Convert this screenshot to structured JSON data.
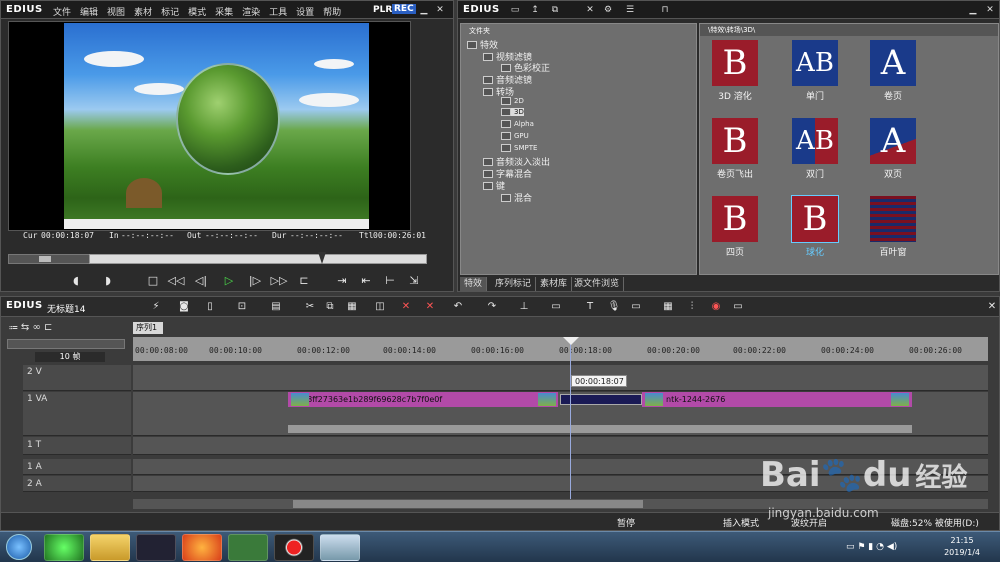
{
  "player": {
    "logo": "EDIUS",
    "menu": [
      "文件",
      "编辑",
      "视图",
      "素材",
      "标记",
      "模式",
      "采集",
      "渲染",
      "工具",
      "设置",
      "帮助"
    ],
    "plr": "PLR",
    "rec": "REC",
    "cur_label": "Cur",
    "cur": "00:00:18:07",
    "in_label": "In",
    "in": "--:--:--:--",
    "out_label": "Out",
    "out": "--:--:--:--",
    "dur_label": "Dur",
    "dur": "--:--:--:--",
    "ttl_label": "Ttl",
    "ttl": "00:00:26:01"
  },
  "effects": {
    "logo": "EDIUS",
    "tree_header": "文件夹",
    "tree": [
      "特效",
      "视频滤镜",
      "色彩校正",
      "音频滤镜",
      "转场",
      "2D",
      "3D",
      "Alpha",
      "GPU",
      "SMPTE",
      "音频淡入淡出",
      "字幕混合",
      "键",
      "混合"
    ],
    "path": "\\特效\\转场\\3D\\",
    "items": [
      {
        "label": "3D 溶化",
        "letter": "B",
        "bg": "#9a1c2a"
      },
      {
        "label": "单门",
        "letter": "AB",
        "bg": "#1a3a8a"
      },
      {
        "label": "卷页",
        "letter": "A",
        "bg": "#1a3a8a"
      },
      {
        "label": "卷页飞出",
        "letter": "B",
        "bg": "#9a1c2a"
      },
      {
        "label": "双门",
        "letter": "AB",
        "bg": "#9a1c2a"
      },
      {
        "label": "双页",
        "letter": "A",
        "bg": "#1a3a8a"
      },
      {
        "label": "四页",
        "letter": "B",
        "bg": "#9a1c2a"
      },
      {
        "label": "球化",
        "letter": "B",
        "bg": "#9a1c2a"
      },
      {
        "label": "百叶窗",
        "letter": "",
        "bg": "#7a1020"
      }
    ],
    "tabs": [
      "特效",
      "序列标记",
      "素材库",
      "源文件浏览"
    ]
  },
  "timeline": {
    "logo": "EDIUS",
    "project": "无标题14",
    "seq_tab": "序列1",
    "zoom": "10 帧",
    "ruler": [
      "00:00:08:00",
      "00:00:10:00",
      "00:00:12:00",
      "00:00:14:00",
      "00:00:16:00",
      "00:00:18:00",
      "00:00:20:00",
      "00:00:22:00",
      "00:00:24:00",
      "00:00:26:00"
    ],
    "tracks": [
      "2 V",
      "1 VA",
      "1 T",
      "1 A",
      "2 A"
    ],
    "clip1": "3a68ff27363e1b289f69628c7b7f0e0f",
    "clip2": "ntk-1244-2676",
    "playhead_time": "00:00:18:07",
    "status": {
      "pause": "暂停",
      "insert_mode": "插入模式",
      "ripple": "波纹开启",
      "disk": "磁盘:52% 被使用(D:)"
    }
  },
  "taskbar": {
    "time": "21:15",
    "date": "2019/1/4"
  },
  "watermark": {
    "brand": "Bai",
    "brand_suffix": "du",
    "jingyan": "经验",
    "url": "jingyan.baidu.com"
  }
}
